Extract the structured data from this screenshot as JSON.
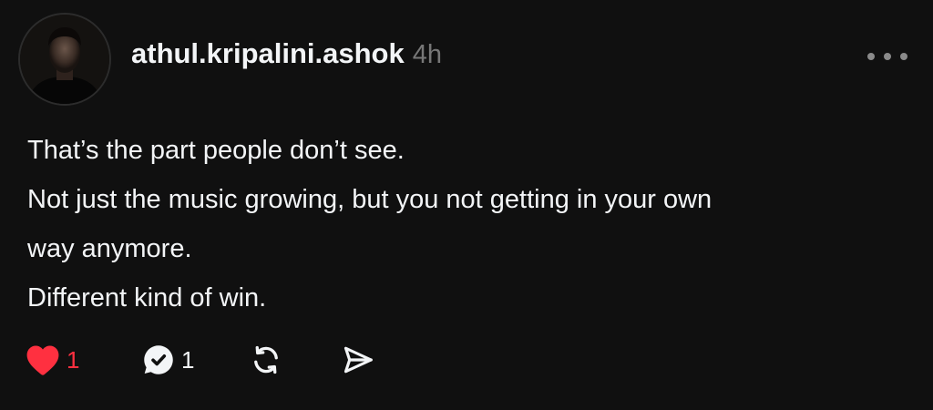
{
  "post": {
    "username": "athul.kripalini.ashok",
    "timestamp": "4h",
    "lines": [
      "That’s the part people don’t see.",
      "Not just the music growing, but you not getting in your own",
      "way anymore.",
      "Different kind of win."
    ],
    "likes": "1",
    "replies": "1",
    "liked": true
  },
  "icons": {
    "like": "heart-icon",
    "reply": "comment-bubble-icon",
    "repost": "repost-icon",
    "share": "send-icon",
    "more": "more-horizontal-icon"
  },
  "colors": {
    "background": "#101010",
    "text": "#f3f5f7",
    "muted": "#777777",
    "like": "#ff3040"
  }
}
